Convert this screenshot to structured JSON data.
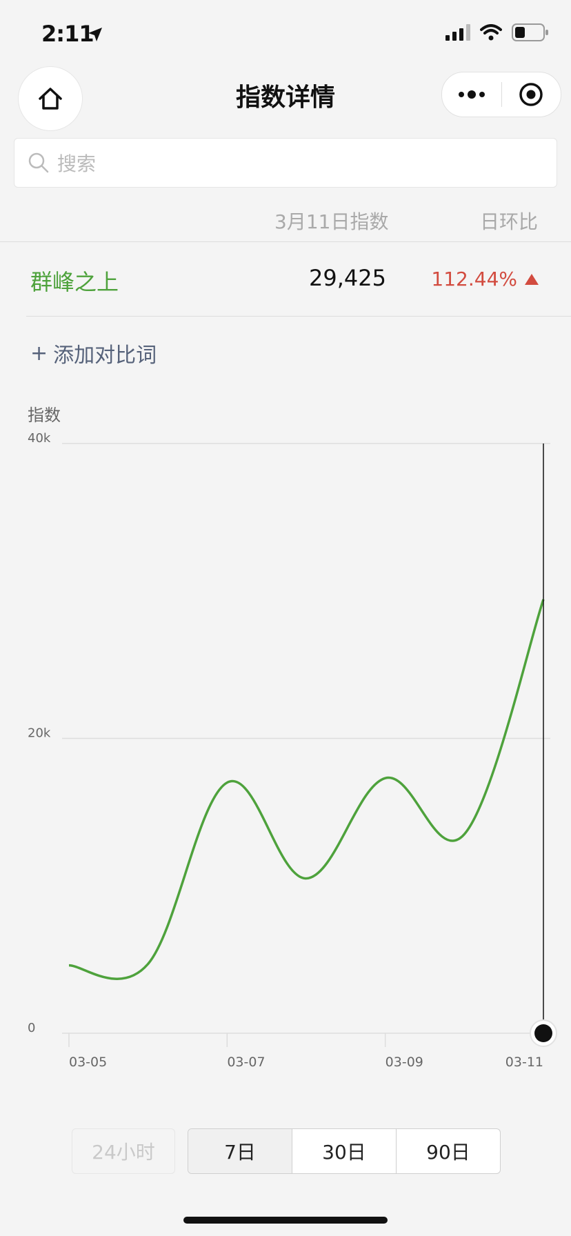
{
  "status_bar": {
    "time": "2:11"
  },
  "nav": {
    "title": "指数详情",
    "more_icon": "more-dots-icon",
    "close_icon": "target-circle-icon",
    "home_icon": "home-icon"
  },
  "search": {
    "placeholder": "搜索",
    "icon": "search-icon"
  },
  "table": {
    "header_index": "3月11日指数",
    "header_change": "日环比",
    "term": "群峰之上",
    "value": "29,425",
    "change": "112.44%",
    "change_direction": "up",
    "change_color": "#d24b3f",
    "term_color": "#4ea23c"
  },
  "add_compare": {
    "label": "添加对比词",
    "plus": "+"
  },
  "chart_data": {
    "type": "line",
    "ylabel": "指数",
    "ylim": [
      0,
      40000
    ],
    "y_ticks": [
      {
        "value": 0,
        "label": "0"
      },
      {
        "value": 20000,
        "label": "20k"
      },
      {
        "value": 40000,
        "label": "40k"
      }
    ],
    "x_tick_labels": [
      "03-05",
      "03-07",
      "03-09",
      "03-11"
    ],
    "x": [
      "03-05",
      "03-06",
      "03-07",
      "03-08",
      "03-09",
      "03-10",
      "03-11"
    ],
    "series": [
      {
        "values": [
          4600,
          4700,
          17000,
          10500,
          17300,
          13500,
          29425
        ],
        "color": "#4ea23c"
      }
    ],
    "grid": true,
    "selected_index": 6
  },
  "range_buttons": {
    "disabled": "24小时",
    "options": [
      "7日",
      "30日",
      "90日"
    ],
    "active": "7日"
  }
}
